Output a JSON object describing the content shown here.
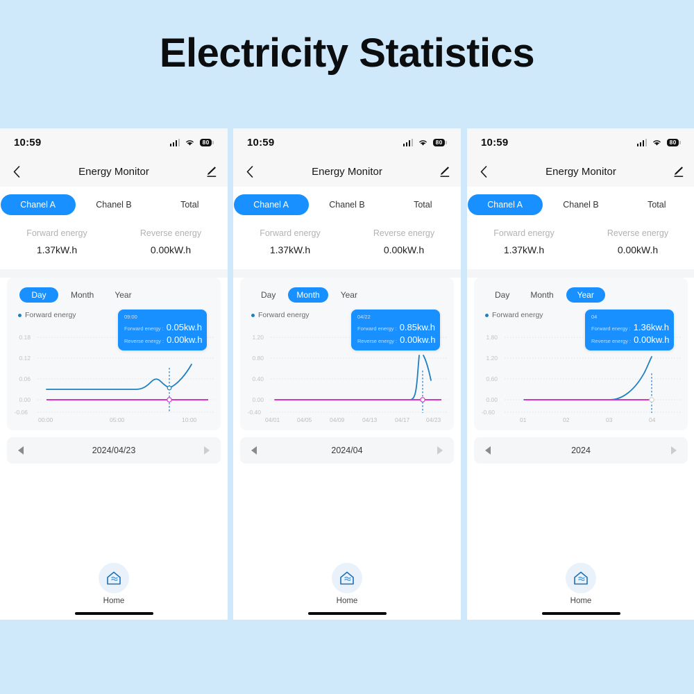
{
  "banner": {
    "title": "Electricity Statistics",
    "background": "#cfe9fb"
  },
  "theme": {
    "accent": "#1890ff",
    "forward_line": "#1f7fc0",
    "reverse_line": "#d83bc8",
    "panel_bg": "#ffffff",
    "card_bg": "#f7f8fa"
  },
  "statusbar": {
    "time": "10:59",
    "battery": "80",
    "signal_icon": "signal-bars-icon",
    "wifi_icon": "wifi-icon",
    "battery_icon": "battery-icon"
  },
  "navbar": {
    "title": "Energy Monitor",
    "back_icon": "chevron-left-icon",
    "edit_icon": "pencil-edit-icon"
  },
  "channels": {
    "tabs": [
      "Chanel A",
      "Chanel B",
      "Total"
    ],
    "active": "Chanel A"
  },
  "energy": {
    "forward_label": "Forward energy",
    "forward_value": "1.37kW.h",
    "reverse_label": "Reverse energy",
    "reverse_value": "0.00kW.h"
  },
  "legend": {
    "forward": "Forward energy",
    "reverse": "Reverse energy"
  },
  "ranges": [
    "Day",
    "Month",
    "Year"
  ],
  "panels": [
    {
      "active_range": "Day",
      "date": "2024/04/23",
      "tooltip": {
        "time": "09:00",
        "forward_key": "Forward energy :",
        "forward_val": "0.05kw.h",
        "reverse_key": "Reverse energy :",
        "reverse_val": "0.00kw.h"
      }
    },
    {
      "active_range": "Month",
      "date": "2024/04",
      "tooltip": {
        "time": "04/22",
        "forward_key": "Forward energy :",
        "forward_val": "0.85kw.h",
        "reverse_key": "Reverse energy :",
        "reverse_val": "0.00kw.h"
      }
    },
    {
      "active_range": "Year",
      "date": "2024",
      "tooltip": {
        "time": "04",
        "forward_key": "Forward energy :",
        "forward_val": "1.36kw.h",
        "reverse_key": "Reverse energy :",
        "reverse_val": "0.00kw.h"
      }
    }
  ],
  "bottom": {
    "home_label": "Home",
    "home_icon": "home-house-icon"
  },
  "chart_data": [
    {
      "type": "line",
      "title": "Day",
      "xlabel": "",
      "ylabel": "kw.h",
      "yticks": [
        "0.18",
        "0.12",
        "0.06",
        "0.00",
        "-0.06"
      ],
      "ylim": [
        -0.06,
        0.18
      ],
      "xticks": [
        "00:00",
        "05:00",
        "10:00"
      ],
      "xlim": [
        0,
        10
      ],
      "grid": true,
      "legend_position": "top-left",
      "highlight_x": "09:00",
      "series": [
        {
          "name": "Forward energy",
          "color": "#1f7fc0",
          "x": [
            0,
            1,
            2,
            3,
            4,
            5,
            6,
            6.6,
            7.2,
            7.8,
            8.4,
            9.0,
            9.5,
            10
          ],
          "values": [
            0.031,
            0.031,
            0.031,
            0.031,
            0.031,
            0.031,
            0.031,
            0.034,
            0.052,
            0.061,
            0.055,
            0.05,
            0.085,
            0.115
          ]
        },
        {
          "name": "Reverse energy",
          "color": "#d83bc8",
          "x": [
            0,
            2,
            4,
            6,
            8,
            9,
            10
          ],
          "values": [
            0,
            0,
            0,
            0,
            0,
            0,
            0
          ]
        }
      ]
    },
    {
      "type": "line",
      "title": "Month",
      "xlabel": "",
      "ylabel": "kw.h",
      "yticks": [
        "1.20",
        "0.80",
        "0.40",
        "0.00",
        "-0.40"
      ],
      "ylim": [
        -0.4,
        1.2
      ],
      "xticks": [
        "04/01",
        "04/05",
        "04/09",
        "04/13",
        "04/17",
        "04/23"
      ],
      "xlim": [
        1,
        23
      ],
      "grid": true,
      "legend_position": "top-left",
      "highlight_x": "04/22",
      "series": [
        {
          "name": "Forward energy",
          "color": "#1f7fc0",
          "x": [
            1,
            5,
            9,
            13,
            17,
            20,
            21,
            22,
            23
          ],
          "values": [
            0,
            0,
            0,
            0,
            0,
            0,
            0.02,
            0.85,
            0.52
          ]
        },
        {
          "name": "Reverse energy",
          "color": "#d83bc8",
          "x": [
            1,
            5,
            9,
            13,
            17,
            21,
            23
          ],
          "values": [
            0,
            0,
            0,
            0,
            0,
            0,
            0
          ]
        }
      ]
    },
    {
      "type": "line",
      "title": "Year",
      "xlabel": "",
      "ylabel": "kw.h",
      "yticks": [
        "1.80",
        "1.20",
        "0.60",
        "0.00",
        "-0.60"
      ],
      "ylim": [
        -0.6,
        1.8
      ],
      "xticks": [
        "01",
        "02",
        "03",
        "04"
      ],
      "xlim": [
        1,
        4
      ],
      "grid": true,
      "legend_position": "top-left",
      "highlight_x": "04",
      "series": [
        {
          "name": "Forward energy",
          "color": "#1f7fc0",
          "x": [
            1,
            2,
            3,
            3.4,
            3.7,
            4
          ],
          "values": [
            0,
            0,
            0,
            0.25,
            0.72,
            1.36
          ]
        },
        {
          "name": "Reverse energy",
          "color": "#d83bc8",
          "x": [
            1,
            2,
            3,
            4
          ],
          "values": [
            0,
            0,
            0,
            0
          ]
        }
      ]
    }
  ]
}
